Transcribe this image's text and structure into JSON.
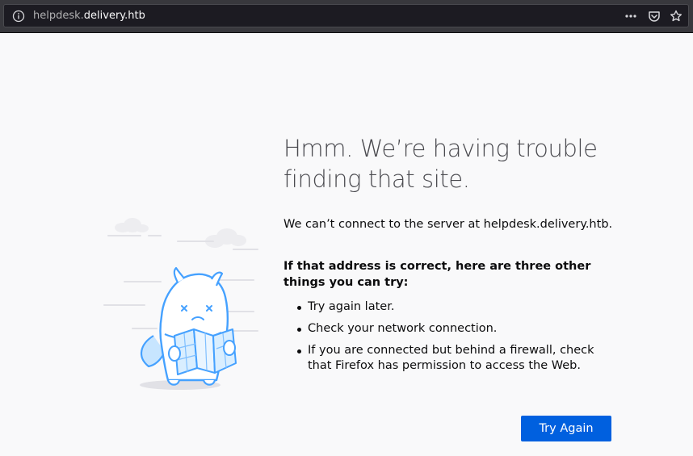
{
  "browser": {
    "url_subdomain": "helpdesk.",
    "url_domain": "delivery.htb",
    "icons": [
      "info-icon",
      "page-actions-icon",
      "pocket-icon",
      "bookmark-star-icon"
    ]
  },
  "error_page": {
    "title": "Hmm. We’re having trouble finding that site.",
    "description": "We can’t connect to the server at helpdesk.delivery.htb.",
    "suggestions_heading": "If that address is correct, here are three other things you can try:",
    "suggestions": [
      "Try again later.",
      "Check your network connection.",
      "If you are connected but behind a firewall, check that Firefox has permission to access the Web."
    ],
    "try_again_label": "Try Again"
  },
  "colors": {
    "toolbar": "#38383d",
    "urlbar": "#1c1b22",
    "page_background": "#f9f9fa",
    "accent_blue": "#0060df",
    "illustration_blue": "#45a1ff"
  }
}
